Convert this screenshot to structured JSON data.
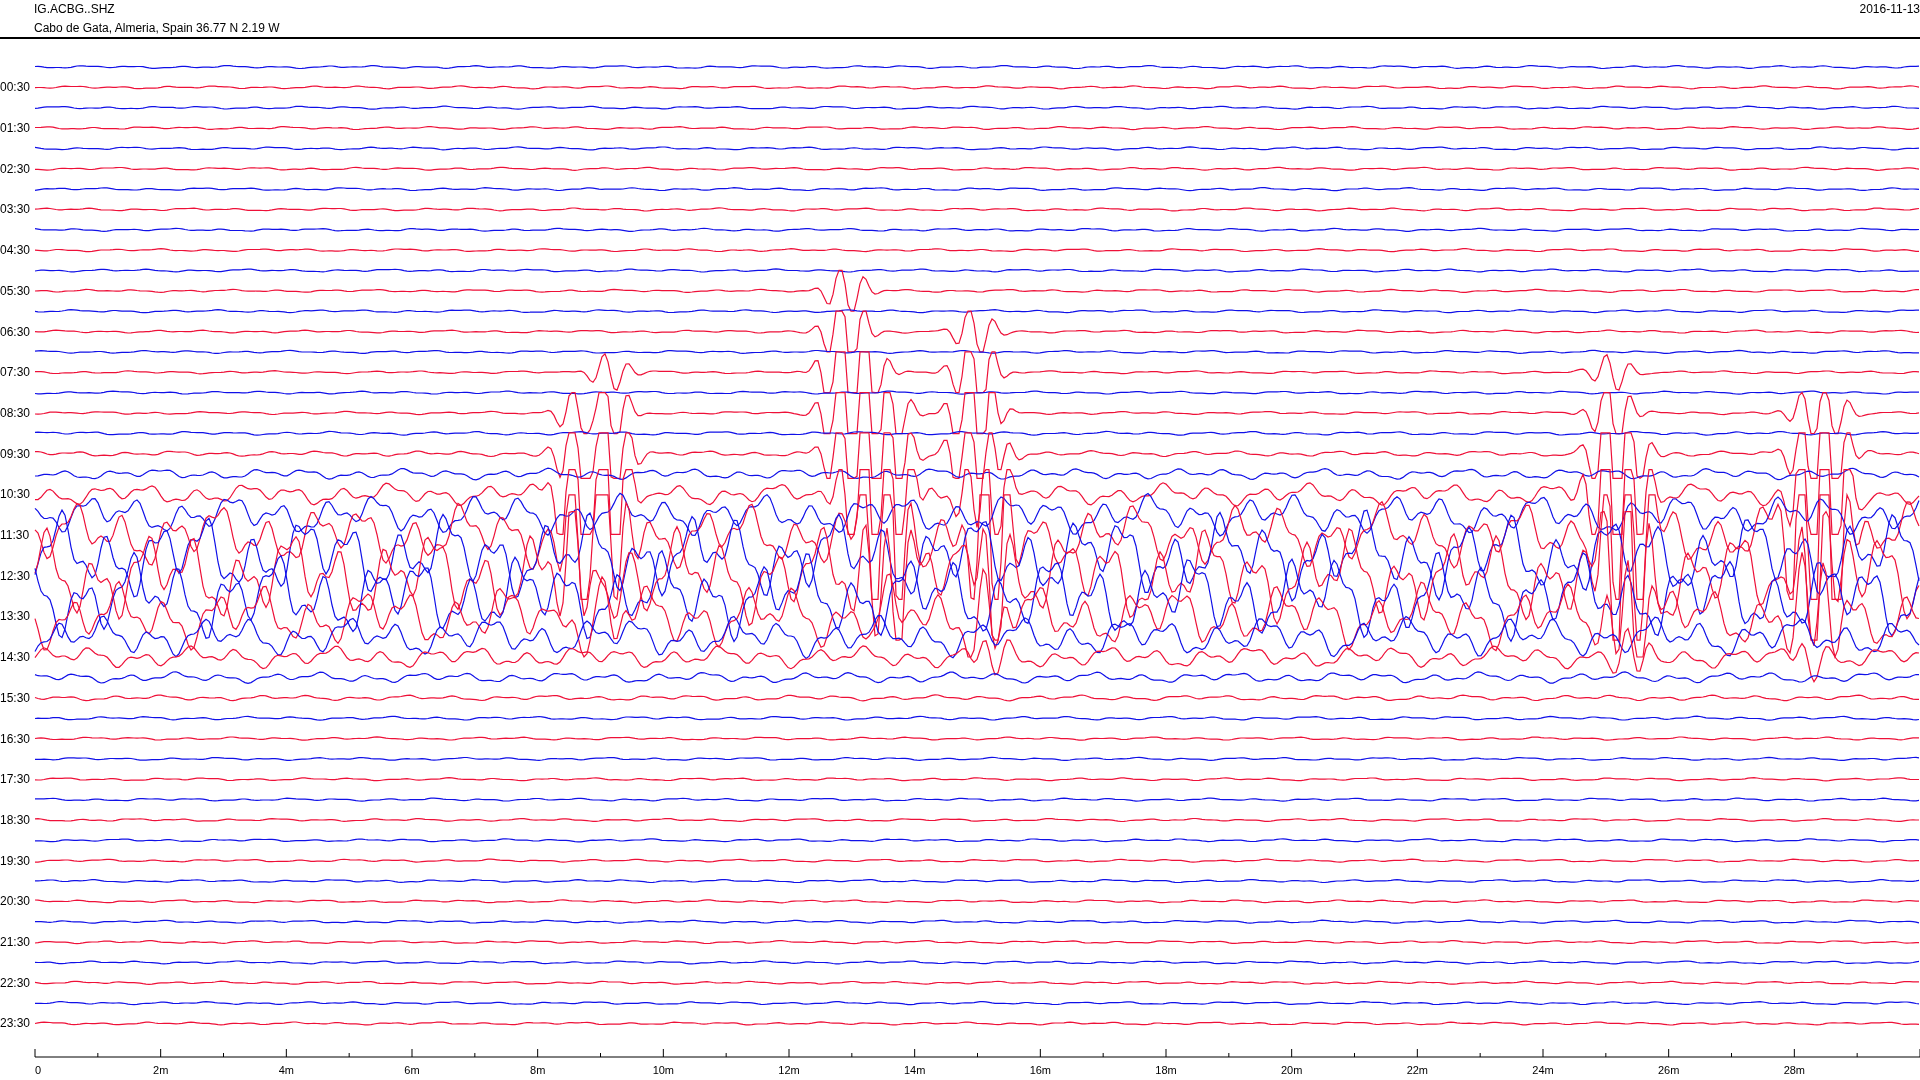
{
  "header": {
    "station": "IG.ACBG..SHZ",
    "location": "Cabo de Gata, Almeria, Spain  36.77 N 2.19 W",
    "date": "2016-11-13"
  },
  "rows": [
    {
      "color": "#1010e8"
    },
    {
      "label": "00:30",
      "color": "#ee1038"
    },
    {
      "color": "#1010e8"
    },
    {
      "label": "01:30",
      "color": "#ee1038"
    },
    {
      "color": "#1010e8"
    },
    {
      "label": "02:30",
      "color": "#ee1038"
    },
    {
      "color": "#1010e8"
    },
    {
      "label": "03:30",
      "color": "#ee1038"
    },
    {
      "color": "#1010e8"
    },
    {
      "label": "04:30",
      "color": "#ee1038"
    },
    {
      "color": "#1010e8"
    },
    {
      "label": "05:30",
      "color": "#ee1038"
    },
    {
      "color": "#1010e8"
    },
    {
      "label": "06:30",
      "color": "#ee1038"
    },
    {
      "color": "#1010e8"
    },
    {
      "label": "07:30",
      "color": "#ee1038"
    },
    {
      "color": "#1010e8"
    },
    {
      "label": "08:30",
      "color": "#ee1038"
    },
    {
      "color": "#1010e8"
    },
    {
      "label": "09:30",
      "color": "#ee1038"
    },
    {
      "color": "#1010e8"
    },
    {
      "label": "10:30",
      "color": "#ee1038"
    },
    {
      "color": "#1010e8"
    },
    {
      "label": "11:30",
      "color": "#ee1038"
    },
    {
      "color": "#1010e8"
    },
    {
      "label": "12:30",
      "color": "#ee1038"
    },
    {
      "color": "#1010e8"
    },
    {
      "label": "13:30",
      "color": "#ee1038"
    },
    {
      "color": "#1010e8"
    },
    {
      "label": "14:30",
      "color": "#ee1038"
    },
    {
      "color": "#1010e8"
    },
    {
      "label": "15:30",
      "color": "#ee1038"
    },
    {
      "color": "#1010e8"
    },
    {
      "label": "16:30",
      "color": "#ee1038"
    },
    {
      "color": "#1010e8"
    },
    {
      "label": "17:30",
      "color": "#ee1038"
    },
    {
      "color": "#1010e8"
    },
    {
      "label": "18:30",
      "color": "#ee1038"
    },
    {
      "color": "#1010e8"
    },
    {
      "label": "19:30",
      "color": "#ee1038"
    },
    {
      "color": "#1010e8"
    },
    {
      "label": "20:30",
      "color": "#ee1038"
    },
    {
      "color": "#1010e8"
    },
    {
      "label": "21:30",
      "color": "#ee1038"
    },
    {
      "color": "#1010e8"
    },
    {
      "label": "22:30",
      "color": "#ee1038"
    },
    {
      "color": "#1010e8"
    },
    {
      "label": "23:30",
      "color": "#ee1038"
    }
  ],
  "x_axis": {
    "labels": [
      "0",
      "2m",
      "4m",
      "6m",
      "8m",
      "10m",
      "12m",
      "14m",
      "16m",
      "18m",
      "20m",
      "22m",
      "24m",
      "26m",
      "28m"
    ]
  }
}
